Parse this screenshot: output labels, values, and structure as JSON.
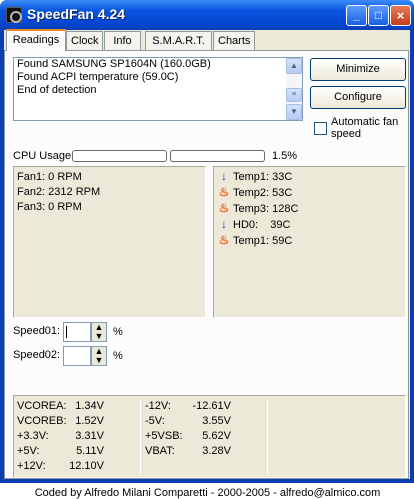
{
  "window": {
    "title": "SpeedFan 4.24",
    "minimize_glyph": "_",
    "maximize_glyph": "□",
    "close_glyph": "×"
  },
  "tabs": [
    {
      "label": "Readings"
    },
    {
      "label": "Clock"
    },
    {
      "label": "Info"
    },
    {
      "label": "S.M.A.R.T."
    },
    {
      "label": "Charts"
    }
  ],
  "log": {
    "lines": [
      "Found SAMSUNG SP1604N (160.0GB)",
      "Found ACPI temperature (59.0C)",
      "End of detection"
    ]
  },
  "buttons": {
    "minimize": "Minimize",
    "configure": "Configure"
  },
  "auto_fan": {
    "label_line1": "Automatic fan",
    "label_line2": "speed",
    "checked": false
  },
  "cpu": {
    "label": "CPU Usage",
    "bar1_fraction": 0.0,
    "bar2_fraction": 0.0,
    "percent": "1.5%"
  },
  "fans": [
    "Fan1: 0 RPM",
    "Fan2: 2312 RPM",
    "Fan3: 0 RPM"
  ],
  "temps": [
    {
      "icon": "arrow-down-icon",
      "text": "Temp1: 33C"
    },
    {
      "icon": "flame-icon",
      "text": "Temp2: 53C"
    },
    {
      "icon": "flame-icon",
      "text": "Temp3: 128C"
    },
    {
      "icon": "arrow-down-icon",
      "text": "HD0:    39C"
    },
    {
      "icon": "flame-icon",
      "text": "Temp1: 59C"
    }
  ],
  "speeds": [
    {
      "label": "Speed01:",
      "value": "",
      "unit": "%"
    },
    {
      "label": "Speed02:",
      "value": "",
      "unit": "%"
    }
  ],
  "voltages": {
    "col1": [
      {
        "label": "VCOREA:",
        "value": "1.34V"
      },
      {
        "label": "VCOREB:",
        "value": "1.52V"
      },
      {
        "label": "+3.3V:",
        "value": "3.31V"
      },
      {
        "label": "+5V:",
        "value": "5.11V"
      },
      {
        "label": "+12V:",
        "value": "12.10V"
      }
    ],
    "col2": [
      {
        "label": "-12V:",
        "value": "-12.61V"
      },
      {
        "label": "-5V:",
        "value": "3.55V"
      },
      {
        "label": "+5VSB:",
        "value": "5.62V"
      },
      {
        "label": "VBAT:",
        "value": "3.28V"
      }
    ]
  },
  "footer": "Coded by Alfredo Milani Comparetti - 2000-2005 - alfredo@almico.com",
  "colors": {
    "titlebar": "#0a55e0",
    "panel": "#ece9d8",
    "tab_accent": "#e68b2c",
    "cold_icon": "#1f33c9",
    "hot_icon": "#f06010"
  }
}
